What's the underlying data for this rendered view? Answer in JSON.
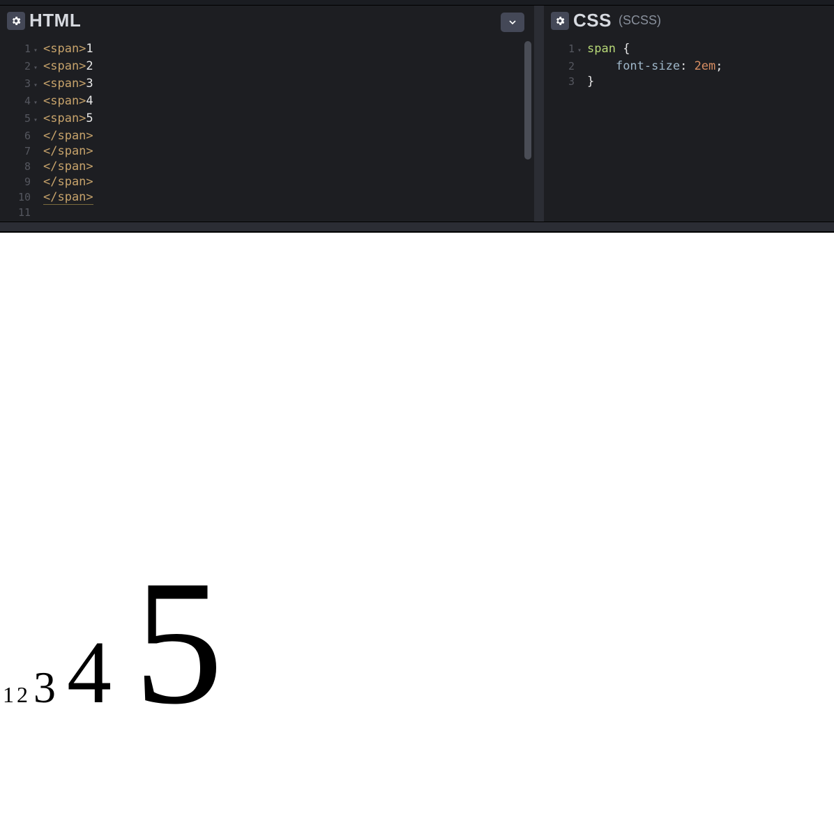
{
  "panels": {
    "html": {
      "title": "HTML",
      "lines": [
        {
          "n": "1",
          "fold": "▾",
          "open": "<span>",
          "text": "1"
        },
        {
          "n": "2",
          "fold": "▾",
          "open": "<span>",
          "text": "2"
        },
        {
          "n": "3",
          "fold": "▾",
          "open": "<span>",
          "text": "3"
        },
        {
          "n": "4",
          "fold": "▾",
          "open": "<span>",
          "text": "4"
        },
        {
          "n": "5",
          "fold": "▾",
          "open": "<span>",
          "text": "5"
        },
        {
          "n": "6",
          "fold": "",
          "close": "</span>"
        },
        {
          "n": "7",
          "fold": "",
          "close": "</span>"
        },
        {
          "n": "8",
          "fold": "",
          "close": "</span>"
        },
        {
          "n": "9",
          "fold": "",
          "close": "</span>"
        },
        {
          "n": "10",
          "fold": "",
          "close": "</span>",
          "underline": true
        },
        {
          "n": "11",
          "fold": "",
          "blank": true
        }
      ]
    },
    "css": {
      "title": "CSS",
      "subtitle": "(SCSS)",
      "lines": [
        {
          "n": "1",
          "fold": "▾",
          "sel": "span",
          "sp": " ",
          "brace": "{"
        },
        {
          "n": "2",
          "fold": "",
          "indent": "    ",
          "prop": "font-size",
          "colon": ": ",
          "val": "2em",
          "semi": ";"
        },
        {
          "n": "3",
          "fold": "",
          "brace": "}"
        }
      ]
    }
  },
  "preview": {
    "values": [
      "1",
      "2",
      "3",
      "4",
      "5"
    ]
  }
}
